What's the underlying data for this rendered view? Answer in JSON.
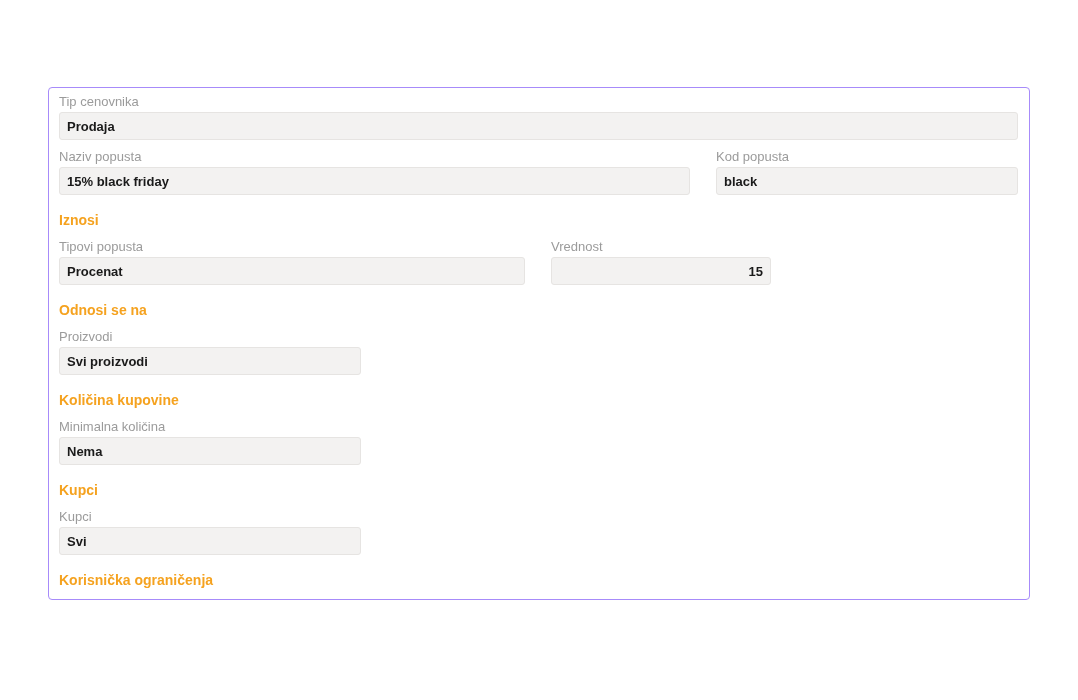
{
  "sections": [
    {
      "rows": [
        [
          {
            "label": "Tip cenovnika",
            "value": "Prodaja",
            "kind": "text"
          }
        ],
        [
          {
            "label": "Naziv popusta",
            "value": "15% black friday",
            "kind": "text"
          },
          {
            "label": "Kod popusta",
            "value": "black",
            "kind": "text"
          }
        ]
      ]
    },
    {
      "heading": "Iznosi",
      "rows": [
        [
          {
            "label": "Tipovi popusta",
            "value": "Procenat",
            "kind": "text"
          },
          {
            "label": "Vrednost",
            "value": "15",
            "kind": "number"
          }
        ]
      ]
    },
    {
      "heading": "Odnosi se na",
      "rows": [
        [
          {
            "label": "Proizvodi",
            "value": "Svi proizvodi",
            "kind": "text"
          }
        ]
      ]
    },
    {
      "heading": "Količina kupovine",
      "rows": [
        [
          {
            "label": "Minimalna količina",
            "value": "Nema",
            "kind": "text"
          }
        ]
      ]
    },
    {
      "heading": "Kupci",
      "rows": [
        [
          {
            "label": "Kupci",
            "value": "Svi",
            "kind": "text"
          }
        ]
      ]
    },
    {
      "heading": "Korisnička ograničenja"
    }
  ]
}
